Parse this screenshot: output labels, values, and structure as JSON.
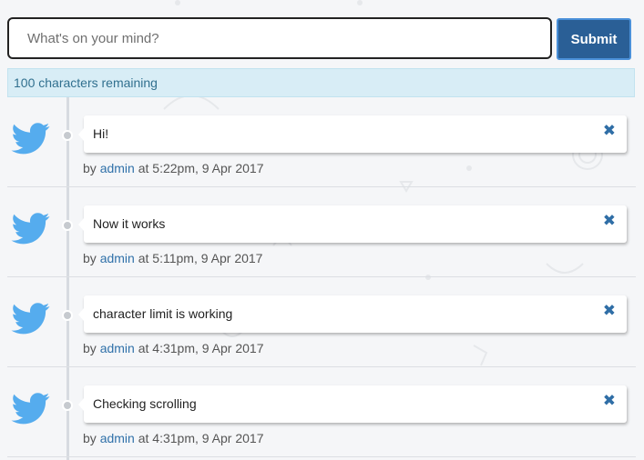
{
  "composer": {
    "placeholder": "What's on your mind?",
    "value": "",
    "submit_label": "Submit"
  },
  "counter": {
    "text": "100 characters remaining"
  },
  "meta_labels": {
    "by": "by",
    "at": "at"
  },
  "colors": {
    "brand_blue": "#55acee",
    "button": "#2a5f96",
    "link": "#3071a9",
    "counter_bg": "#d8edf6"
  },
  "icons": {
    "post_avatar": "twitter-bird-icon",
    "delete": "close-icon"
  },
  "posts": [
    {
      "text": "Hi!",
      "author": "admin",
      "time": "5:22pm, 9 Apr 2017"
    },
    {
      "text": "Now it works",
      "author": "admin",
      "time": "5:11pm, 9 Apr 2017"
    },
    {
      "text": "character limit is working",
      "author": "admin",
      "time": "4:31pm, 9 Apr 2017"
    },
    {
      "text": "Checking scrolling",
      "author": "admin",
      "time": "4:31pm, 9 Apr 2017"
    }
  ]
}
